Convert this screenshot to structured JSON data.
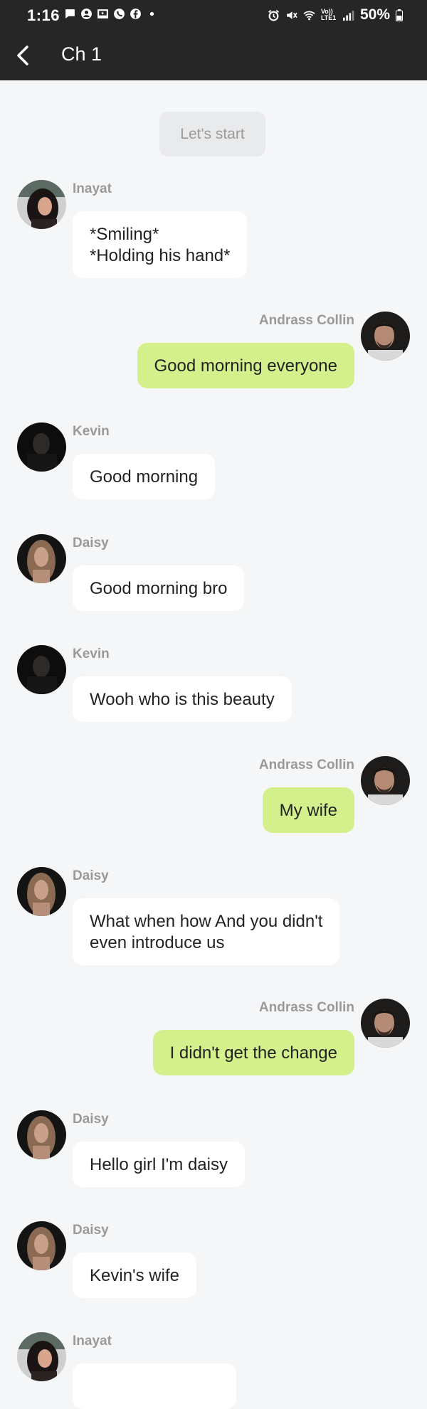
{
  "status_bar": {
    "time": "1:16",
    "battery": "50%",
    "network": "Vo)) LTE1"
  },
  "header": {
    "title": "Ch 1",
    "back_icon": "chevron-left-icon"
  },
  "start_button": {
    "label": "Let's start"
  },
  "colors": {
    "header_bg": "#262626",
    "page_bg": "#f5f6f8",
    "incoming_bubble": "#ffffff",
    "outgoing_bubble": "#d4f08c",
    "sender_name": "#999999"
  },
  "messages": [
    {
      "sender": "Inayat",
      "side": "left",
      "text": "*Smiling*\n*Holding his hand*"
    },
    {
      "sender": "Andrass Collin",
      "side": "right",
      "text": "Good morning everyone"
    },
    {
      "sender": "Kevin",
      "side": "left",
      "text": "Good morning"
    },
    {
      "sender": "Daisy",
      "side": "left",
      "text": "Good morning bro"
    },
    {
      "sender": "Kevin",
      "side": "left",
      "text": "Wooh who is this beauty"
    },
    {
      "sender": "Andrass Collin",
      "side": "right",
      "text": "My wife"
    },
    {
      "sender": "Daisy",
      "side": "left",
      "text": "What when how And you didn't\neven introduce us"
    },
    {
      "sender": "Andrass Collin",
      "side": "right",
      "text": "I didn't get the change"
    },
    {
      "sender": "Daisy",
      "side": "left",
      "text": "Hello girl I'm daisy"
    },
    {
      "sender": "Daisy",
      "side": "left",
      "text": "Kevin's wife"
    },
    {
      "sender": "Inayat",
      "side": "left",
      "text": ""
    }
  ]
}
